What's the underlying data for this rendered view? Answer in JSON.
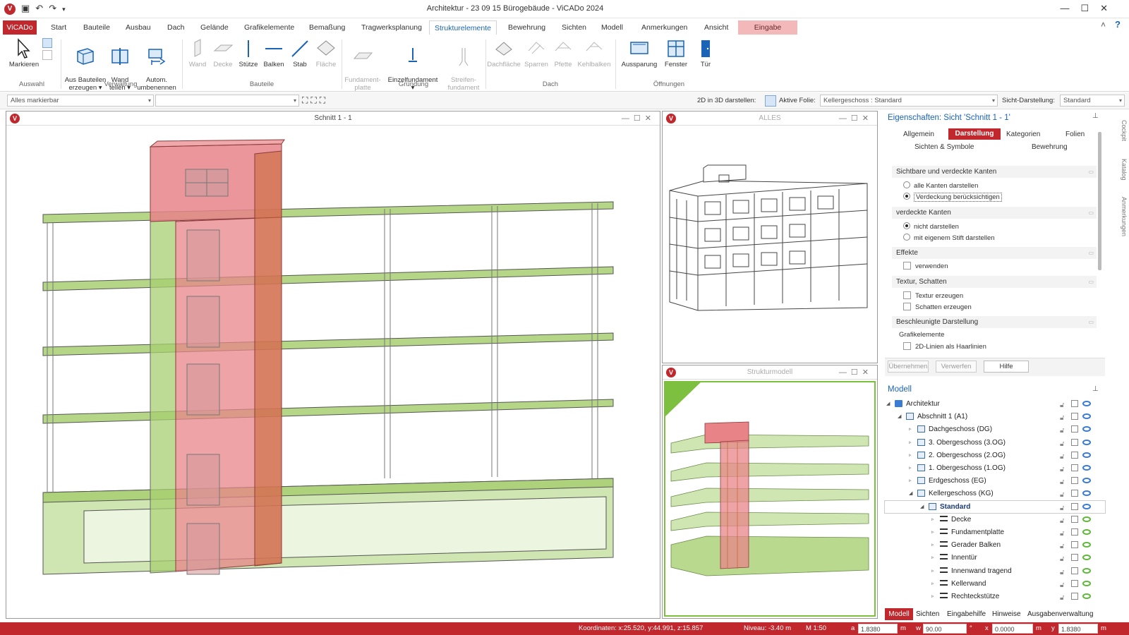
{
  "app": {
    "title": "Architektur - 23 09 15 Bürogebäude - ViCADo 2024",
    "logo": "V"
  },
  "menu_tabs": [
    "ViCADo",
    "Start",
    "Bauteile",
    "Ausbau",
    "Dach",
    "Gelände",
    "Grafikelemente",
    "Bemaßung",
    "Tragwerksplanung",
    "Strukturelemente",
    "Bewehrung",
    "Sichten",
    "Modell",
    "Anmerkungen",
    "Ansicht",
    "Eingabe"
  ],
  "active_tab": "Strukturelemente",
  "ribbon": {
    "buttons": [
      {
        "label": "Markieren",
        "icon": "cursor-icon"
      },
      {
        "label": "Aus Bauteilen\nerzeugen ▾",
        "icon": "struct-from-parts-icon"
      },
      {
        "label": "Wand\nteilen ▾",
        "icon": "wall-split-icon"
      },
      {
        "label": "Autom.\numbenennen",
        "icon": "rename-icon"
      },
      {
        "label": "Wand",
        "icon": "wall-icon"
      },
      {
        "label": "Decke",
        "icon": "slab-icon"
      },
      {
        "label": "Stütze",
        "icon": "column-icon"
      },
      {
        "label": "Balken",
        "icon": "beam-icon"
      },
      {
        "label": "Stab",
        "icon": "bar-icon"
      },
      {
        "label": "Fläche",
        "icon": "area-icon"
      },
      {
        "label": "Fundament-\nplatte",
        "icon": "foundation-plate-icon"
      },
      {
        "label": "Einzelfundament\n▾",
        "icon": "single-footing-icon"
      },
      {
        "label": "Streifen-\nfundament",
        "icon": "strip-footing-icon"
      },
      {
        "label": "Dachfläche",
        "icon": "roof-area-icon"
      },
      {
        "label": "Sparren",
        "icon": "rafter-icon"
      },
      {
        "label": "Pfette",
        "icon": "purlin-icon"
      },
      {
        "label": "Kehlbalken",
        "icon": "collar-beam-icon"
      },
      {
        "label": "Aussparung",
        "icon": "opening-icon"
      },
      {
        "label": "Fenster",
        "icon": "window-icon"
      },
      {
        "label": "Tür",
        "icon": "door-icon"
      }
    ],
    "groups": [
      "Auswahl",
      "Verwaltung",
      "Bauteile",
      "Gründung",
      "Dach",
      "Öffnungen"
    ]
  },
  "optbar": {
    "selection_filter": "Alles markierbar",
    "second_combo": "",
    "label_2d3d": "2D in 3D darstellen:",
    "label_folie": "Aktive Folie:",
    "folie_value": "Kellergeschoss : Standard",
    "label_sicht": "Sicht-Darstellung:",
    "sicht_value": "Standard"
  },
  "windows": {
    "main": {
      "title": "Schnitt 1 - 1"
    },
    "top_right": {
      "title": "ALLES"
    },
    "bottom_right": {
      "title": "Strukturmodell"
    }
  },
  "properties": {
    "title": "Eigenschaften: Sicht 'Schnitt 1 - 1'",
    "tabs": [
      "Allgemein",
      "Darstellung",
      "Kategorien",
      "Folien",
      "Sichten & Symbole",
      "Bewehrung"
    ],
    "active_tab": "Darstellung",
    "sections": {
      "kanten": "Sichtbare und verdeckte Kanten",
      "kanten_opt1": "alle Kanten darstellen",
      "kanten_opt2": "Verdeckung berücksichtigen",
      "verdeckt": "verdeckte Kanten",
      "verdeckt_opt1": "nicht darstellen",
      "verdeckt_opt2": "mit eigenem Stift darstellen",
      "effekte": "Effekte",
      "effekte_opt": "verwenden",
      "textur": "Textur, Schatten",
      "textur_opt1": "Textur erzeugen",
      "textur_opt2": "Schatten erzeugen",
      "beschl": "Beschleunigte Darstellung",
      "grafik": "Grafikelemente",
      "grafik_opt": "2D-Linien als Haarlinien"
    },
    "buttons": {
      "apply": "Übernehmen",
      "discard": "Verwerfen",
      "help": "Hilfe"
    }
  },
  "model": {
    "title": "Modell",
    "tree": [
      {
        "label": "Architektur",
        "level": 0,
        "bold": false
      },
      {
        "label": "Abschnitt 1 (A1)",
        "level": 1,
        "bold": false
      },
      {
        "label": "Dachgeschoss (DG)",
        "level": 2,
        "bold": false
      },
      {
        "label": "3. Obergeschoss (3.OG)",
        "level": 2,
        "bold": false
      },
      {
        "label": "2. Obergeschoss (2.OG)",
        "level": 2,
        "bold": false
      },
      {
        "label": "1. Obergeschoss (1.OG)",
        "level": 2,
        "bold": false
      },
      {
        "label": "Erdgeschoss (EG)",
        "level": 2,
        "bold": false
      },
      {
        "label": "Kellergeschoss (KG)",
        "level": 2,
        "bold": false
      },
      {
        "label": "Standard",
        "level": 3,
        "bold": true
      },
      {
        "label": "Decke",
        "level": 4,
        "bold": false
      },
      {
        "label": "Fundamentplatte",
        "level": 4,
        "bold": false
      },
      {
        "label": "Gerader Balken",
        "level": 4,
        "bold": false
      },
      {
        "label": "Innentür",
        "level": 4,
        "bold": false
      },
      {
        "label": "Innenwand tragend",
        "level": 4,
        "bold": false
      },
      {
        "label": "Kellerwand",
        "level": 4,
        "bold": false
      },
      {
        "label": "Rechteckstütze",
        "level": 4,
        "bold": false
      }
    ],
    "bottom_tabs": [
      "Modell",
      "Sichten",
      "Eingabehilfe",
      "Hinweise",
      "Ausgabenverwaltung"
    ],
    "active_bottom_tab": "Modell"
  },
  "side_tabs": [
    "Cockpit",
    "Katalog",
    "Anmerkungen"
  ],
  "status": {
    "coords": "Koordinaten: x:25.520, y:44.991, z:15.857",
    "niveau": "Niveau: -3.40 m",
    "scale": "M 1:50",
    "a_label": "a",
    "a_value": "1.8380",
    "a_unit": "m",
    "w_label": "w",
    "w_value": "90.00",
    "w_unit": "°",
    "x_label": "x",
    "x_value": "0.0000",
    "x_unit": "m",
    "y_label": "y",
    "y_value": "1.8380",
    "y_unit": "m"
  },
  "colors": {
    "brand": "#c0282d",
    "active_tab": "#1a64b8",
    "slab": "#a8cf72",
    "core": "#e88488"
  }
}
